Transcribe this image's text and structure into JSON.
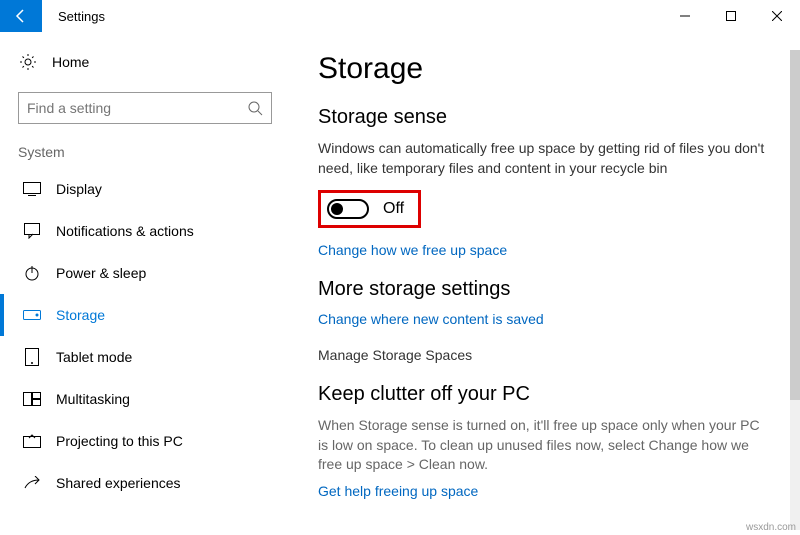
{
  "titlebar": {
    "title": "Settings"
  },
  "sidebar": {
    "home": "Home",
    "search_placeholder": "Find a setting",
    "category": "System",
    "items": [
      {
        "label": "Display"
      },
      {
        "label": "Notifications & actions"
      },
      {
        "label": "Power & sleep"
      },
      {
        "label": "Storage"
      },
      {
        "label": "Tablet mode"
      },
      {
        "label": "Multitasking"
      },
      {
        "label": "Projecting to this PC"
      },
      {
        "label": "Shared experiences"
      }
    ]
  },
  "main": {
    "heading": "Storage",
    "section1_title": "Storage sense",
    "section1_desc": "Windows can automatically free up space by getting rid of files you don't need, like temporary files and content in your recycle bin",
    "toggle_state": "Off",
    "link1": "Change how we free up space",
    "section2_title": "More storage settings",
    "link2": "Change where new content is saved",
    "link3": "Manage Storage Spaces",
    "section3_title": "Keep clutter off your PC",
    "section3_desc": "When Storage sense is turned on, it'll free up space only when your PC is low on space. To clean up unused files now, select Change how we free up space > Clean now.",
    "link4": "Get help freeing up space"
  },
  "footer": "wsxdn.com"
}
